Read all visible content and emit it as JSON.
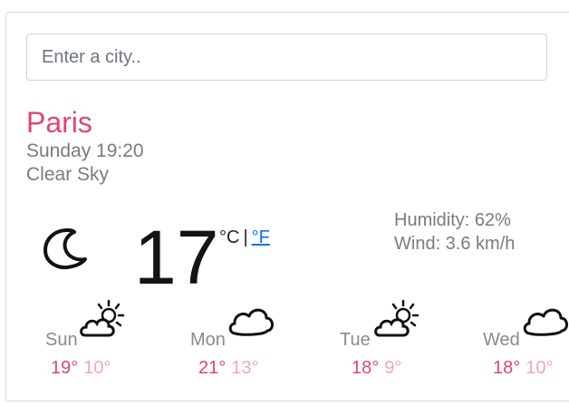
{
  "search": {
    "placeholder": "Enter a city..",
    "value": ""
  },
  "current": {
    "city": "Paris",
    "datetime": "Sunday 19:20",
    "description": "Clear Sky",
    "icon": "moon-icon",
    "temperature": "17",
    "unit_c": "°C",
    "separator": "|",
    "unit_f": "°F",
    "humidity": "Humidity: 62%",
    "wind": "Wind: 3.6 km/h"
  },
  "forecast": [
    {
      "day": "Sun",
      "high": "19°",
      "low": "10°",
      "icon": "sun-behind-cloud-icon"
    },
    {
      "day": "Mon",
      "high": "21°",
      "low": "13°",
      "icon": "cloud-icon"
    },
    {
      "day": "Tue",
      "high": "18°",
      "low": "9°",
      "icon": "sun-behind-cloud-icon"
    },
    {
      "day": "Wed",
      "high": "18°",
      "low": "10°",
      "icon": "cloud-icon"
    }
  ],
  "colors": {
    "accent": "#e0466f",
    "low_temp": "#f0a8bb",
    "link": "#0d6efd",
    "muted_text": "#7b7b7b"
  }
}
